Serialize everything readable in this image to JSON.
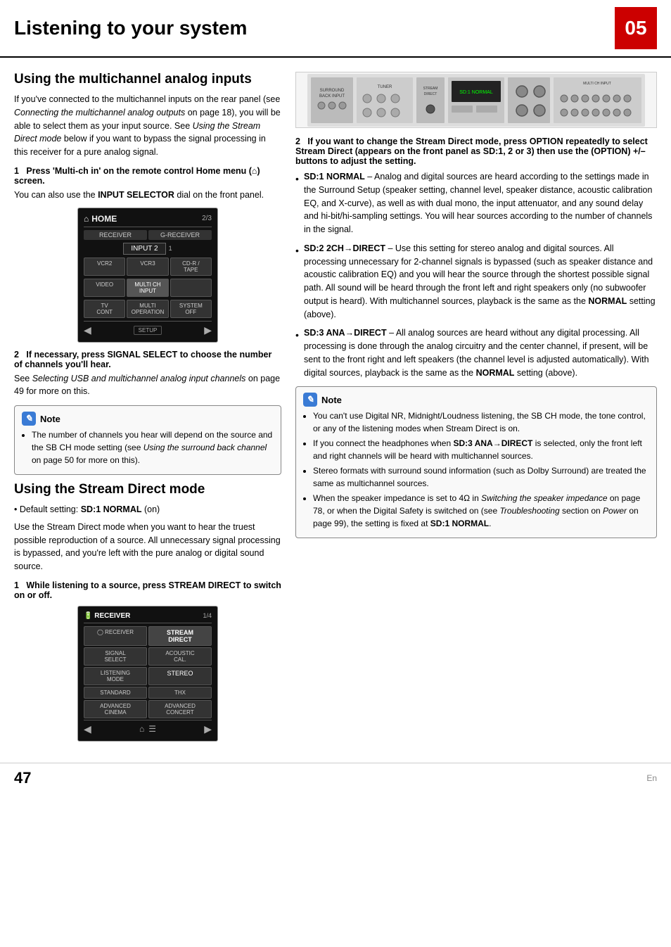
{
  "header": {
    "title": "Listening to your system",
    "chapter": "05"
  },
  "left": {
    "section1": {
      "title": "Using the multichannel analog inputs",
      "body1": "If you've connected to the multichannel inputs on the rear panel (see Connecting the multichannel analog outputs on page 18), you will be able to select them as your input source. See Using the Stream Direct mode below if you want to bypass the signal processing in this receiver for a pure analog signal.",
      "step1_heading": "1   Press 'Multi-ch in' on the remote control Home menu (⌂) screen.",
      "step1_body": "You can also use the INPUT SELECTOR dial on the front panel.",
      "screen1": {
        "title": "HOME",
        "page": "2/3",
        "tabs": [
          "RECEIVER",
          "G-RECEIVER"
        ],
        "input_label": "INPUT 2",
        "btn_row1": [
          "VCR2",
          "VCR3",
          "CD-R / TAPE"
        ],
        "btn_row2": [
          "VIDEO",
          "MULTI CH INPUT",
          ""
        ],
        "btn_row3": [
          "TV CONT",
          "MULTI OPERATION",
          "SYSTEM OFF"
        ],
        "setup_label": "SETUP"
      },
      "step2_heading": "2   If necessary, press SIGNAL SELECT to choose the number of channels you'll hear.",
      "step2_body": "See Selecting USB and multichannel analog input channels on page 49 for more on this.",
      "note": {
        "title": "Note",
        "items": [
          "The number of channels you hear will depend on the source and the SB CH mode setting (see Using the surround back channel on page 50 for more on this)."
        ]
      }
    },
    "section2": {
      "title": "Using the Stream Direct mode",
      "default_setting": "Default setting: SD:1 NORMAL (on)",
      "body": "Use the Stream Direct mode when you want to hear the truest possible reproduction of a source. All unnecessary signal processing is bypassed, and you're left with the pure analog or digital sound source.",
      "step1_heading": "1   While listening to a source, press STREAM DIRECT to switch on or off.",
      "receiver_screen": {
        "title": "RECEIVER",
        "page": "1/4",
        "top_right": "STREAM DIRECT",
        "row1": [
          "SIGNAL SELECT",
          "ACOUSTIC CAL."
        ],
        "row2_left": "LISTENING MODE",
        "row2_right": "STEREO",
        "row3_left": "STANDARD",
        "row3_right": "THX",
        "row4_left": "ADVANCED CINEMA",
        "row4_right": "ADVANCED CONCERT"
      }
    }
  },
  "right": {
    "step2_heading": "2   If you want to change the Stream Direct mode, press OPTION repeatedly to select Stream Direct (appears on the front panel as SD:1, 2 or 3) then use the (OPTION) +/– buttons to adjust the setting.",
    "bullets": [
      {
        "label": "SD:1 NORMAL",
        "text": " – Analog and digital sources are heard according to the settings made in the Surround Setup (speaker setting, channel level, speaker distance, acoustic calibration EQ, and X-curve), as well as with dual mono, the input attenuator, and any sound delay and hi-bit/hi-sampling settings. You will hear sources according to the number of channels in the signal."
      },
      {
        "label": "SD:2 2CH→DIRECT",
        "text": " – Use this setting for stereo analog and digital sources. All processing unnecessary for 2-channel signals is bypassed (such as speaker distance and acoustic calibration EQ) and you will hear the source through the shortest possible signal path. All sound will be heard through the front left and right speakers only (no subwoofer output is heard). With multichannel sources, playback is the same as the NORMAL setting (above)."
      },
      {
        "label": "SD:3 ANA→DIRECT",
        "text": " – All analog sources are heard without any digital processing. All processing is done through the analog circuitry and the center channel, if present, will be sent to the front right and left speakers (the channel level is adjusted automatically). With digital sources, playback is the same as the NORMAL setting (above)."
      }
    ],
    "note": {
      "title": "Note",
      "items": [
        "You can't use Digital NR, Midnight/Loudness listening, the SB CH mode, the tone control, or any of the listening modes when Stream Direct is on.",
        "If you connect the headphones when SD:3 ANA→DIRECT is selected, only the front left and right channels will be heard with multichannel sources.",
        "Stereo formats with surround sound information (such as Dolby Surround) are treated the same as multichannel sources.",
        "When the speaker impedance is set to 4Ω in Switching the speaker impedance on page 78, or when the Digital Safety is switched on (see Troubleshooting section on Power on page 99), the setting is fixed at SD:1 NORMAL."
      ]
    }
  },
  "footer": {
    "page_number": "47",
    "lang": "En"
  }
}
